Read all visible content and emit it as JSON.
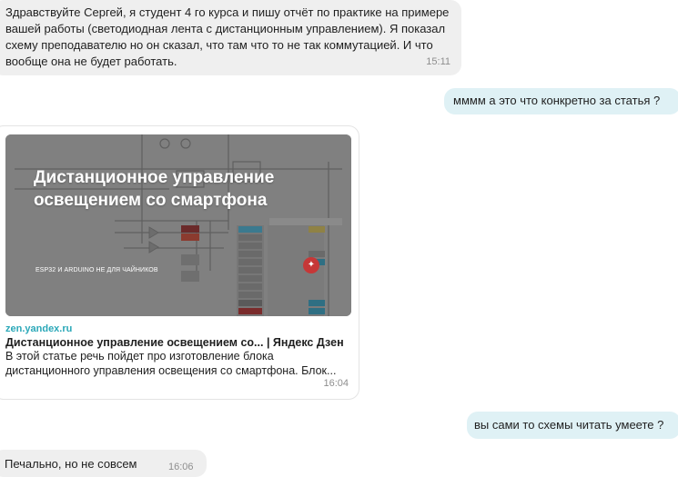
{
  "messages": {
    "m1": {
      "text": "Здравствуйте Сергей, я студент 4 го курса и пишу отчёт по практике на примере вашей работы (светодиодная лента с дистанционным управлением). Я показал схему преподавателю но он сказал, что там что то не так  коммутацией. И что вообще она не будет работать.",
      "time": "15:11"
    },
    "m2": {
      "text": "мммм а это что конкретно за статья ?"
    },
    "m3": {
      "overlay_title": "Дистанционное управление освещением со смартфона",
      "overlay_sub": "ESP32 И ARDUINO НЕ ДЛЯ ЧАЙНИКОВ",
      "domain": "zen.yandex.ru",
      "title": "Дистанционное управление освещением со... | Яндекс Дзен",
      "description": "В этой статье речь пойдет про изготовление блока дистанционного управления освещения со смартфона. Блок...",
      "time": "16:04"
    },
    "m4": {
      "text": "вы сами то схемы читать умеете ?"
    },
    "m5": {
      "text": "Печально, но не совсем",
      "time": "16:06"
    }
  },
  "colors": {
    "incoming_bubble": "#efefef",
    "outgoing_bubble": "#dff1f5",
    "link_domain": "#2ba8b8"
  }
}
